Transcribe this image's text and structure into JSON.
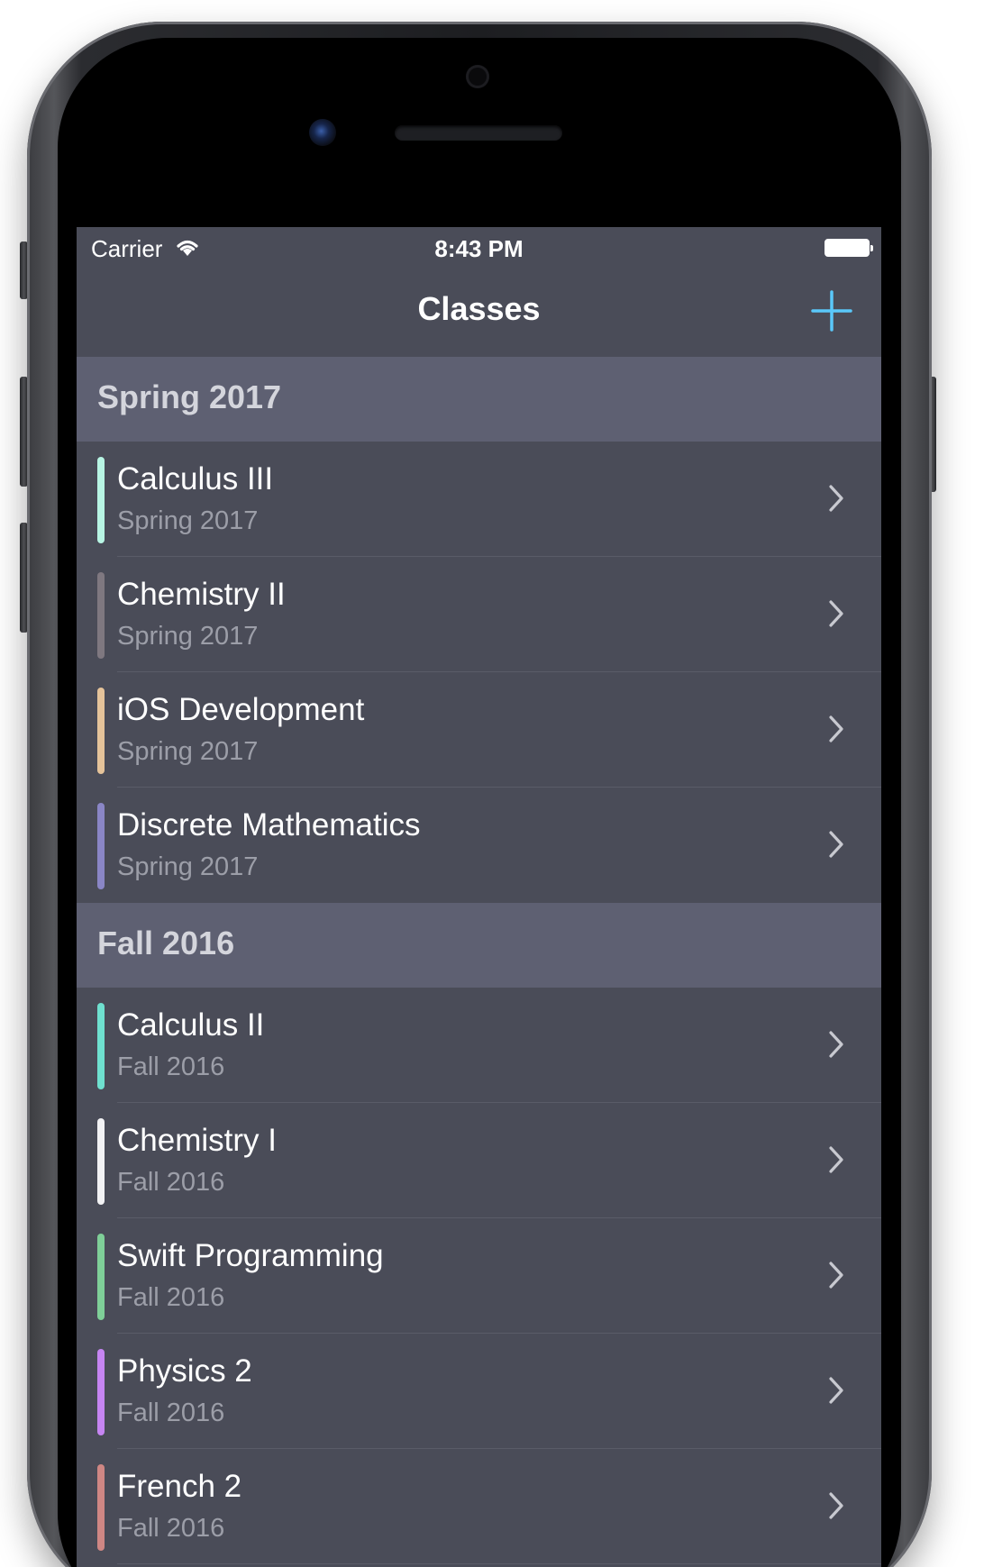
{
  "status_bar": {
    "carrier": "Carrier",
    "time": "8:43 PM",
    "icons": [
      "wifi-icon",
      "battery-icon"
    ]
  },
  "nav_bar": {
    "title": "Classes",
    "add_icon": "plus-icon",
    "accent_color": "#5ac8fa"
  },
  "sections": [
    {
      "title": "Spring 2017",
      "rows": [
        {
          "title": "Calculus III",
          "subtitle": "Spring 2017",
          "color": "#b8f5e4"
        },
        {
          "title": "Chemistry II",
          "subtitle": "Spring 2017",
          "color": "#7f7880"
        },
        {
          "title": "iOS Development",
          "subtitle": "Spring 2017",
          "color": "#e5c39a"
        },
        {
          "title": "Discrete Mathematics",
          "subtitle": "Spring 2017",
          "color": "#8a86c6"
        }
      ]
    },
    {
      "title": "Fall 2016",
      "rows": [
        {
          "title": "Calculus II",
          "subtitle": "Fall 2016",
          "color": "#6fe0cf"
        },
        {
          "title": "Chemistry I",
          "subtitle": "Fall 2016",
          "color": "#f2f2f4"
        },
        {
          "title": "Swift Programming",
          "subtitle": "Fall 2016",
          "color": "#7fcf98"
        },
        {
          "title": "Physics 2",
          "subtitle": "Fall 2016",
          "color": "#c685f2"
        },
        {
          "title": "French 2",
          "subtitle": "Fall 2016",
          "color": "#cf8784"
        }
      ]
    }
  ],
  "theme": {
    "background": "#4a4c58",
    "section_header": "#5e6072",
    "subtitle_text": "#9c9ea8"
  }
}
